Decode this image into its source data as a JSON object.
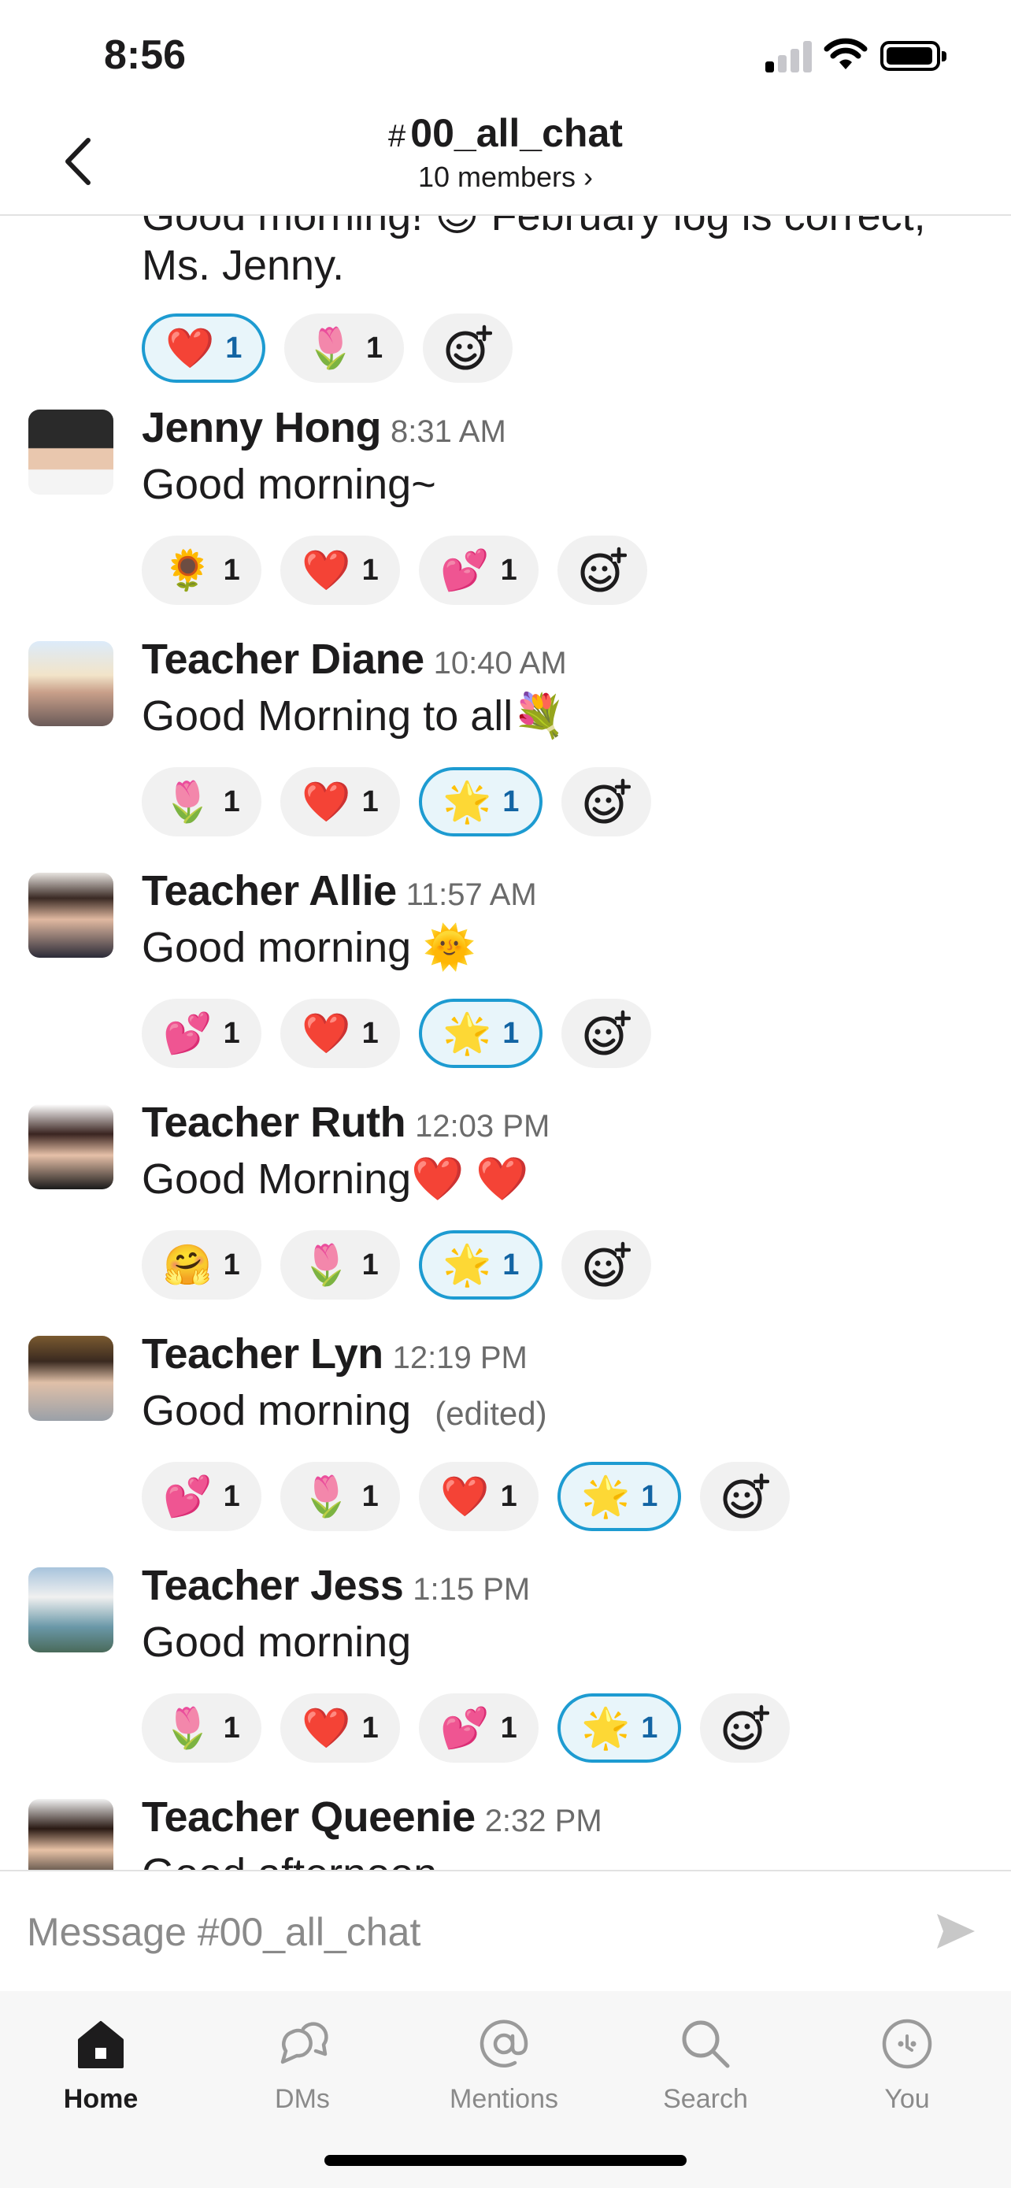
{
  "status": {
    "time": "8:56"
  },
  "header": {
    "hash": "#",
    "channel": "00_all_chat",
    "members": "10 members",
    "members_chevron": "›"
  },
  "partial": {
    "text_line1": "Good morning! 😊 February log is correct,",
    "text_line2": "Ms. Jenny.",
    "reactions": [
      {
        "emoji": "❤️",
        "count": "1",
        "active": true
      },
      {
        "emoji": "🌷",
        "count": "1",
        "active": false
      }
    ]
  },
  "messages": [
    {
      "name": "Jenny Hong",
      "time": "8:31 AM",
      "text": "Good morning~",
      "edited": "",
      "reactions": [
        {
          "emoji": "🌻",
          "count": "1"
        },
        {
          "emoji": "❤️",
          "count": "1"
        },
        {
          "emoji": "💕",
          "count": "1"
        }
      ]
    },
    {
      "name": "Teacher Diane",
      "time": "10:40 AM",
      "text": "Good Morning to all💐",
      "edited": "",
      "reactions": [
        {
          "emoji": "🌷",
          "count": "1"
        },
        {
          "emoji": "❤️",
          "count": "1"
        },
        {
          "emoji": "🌟",
          "count": "1",
          "active": true
        }
      ]
    },
    {
      "name": "Teacher Allie",
      "time": "11:57 AM",
      "text": "Good morning  🌞",
      "edited": "",
      "reactions": [
        {
          "emoji": "💕",
          "count": "1"
        },
        {
          "emoji": "❤️",
          "count": "1"
        },
        {
          "emoji": "🌟",
          "count": "1",
          "active": true
        }
      ]
    },
    {
      "name": "Teacher Ruth",
      "time": "12:03 PM",
      "text": "Good Morning❤️  ❤️",
      "edited": "",
      "reactions": [
        {
          "emoji": "🤗",
          "count": "1"
        },
        {
          "emoji": "🌷",
          "count": "1"
        },
        {
          "emoji": "🌟",
          "count": "1",
          "active": true
        }
      ]
    },
    {
      "name": "Teacher Lyn",
      "time": "12:19 PM",
      "text": "Good morning",
      "edited": "(edited)",
      "reactions": [
        {
          "emoji": "💕",
          "count": "1"
        },
        {
          "emoji": "🌷",
          "count": "1"
        },
        {
          "emoji": "❤️",
          "count": "1"
        },
        {
          "emoji": "🌟",
          "count": "1",
          "active": true
        }
      ]
    },
    {
      "name": "Teacher Jess",
      "time": "1:15 PM",
      "text": "Good morning",
      "edited": "",
      "reactions": [
        {
          "emoji": "🌷",
          "count": "1"
        },
        {
          "emoji": "❤️",
          "count": "1"
        },
        {
          "emoji": "💕",
          "count": "1"
        },
        {
          "emoji": "🌟",
          "count": "1",
          "active": true
        }
      ]
    },
    {
      "name": "Teacher Queenie",
      "time": "2:32 PM",
      "text": "Good afternoon",
      "edited": "",
      "reactions": []
    }
  ],
  "composer": {
    "placeholder": "Message #00_all_chat"
  },
  "tabs": [
    {
      "label": "Home",
      "icon": "home-icon",
      "active": true
    },
    {
      "label": "DMs",
      "icon": "dms-icon"
    },
    {
      "label": "Mentions",
      "icon": "mentions-icon"
    },
    {
      "label": "Search",
      "icon": "search-icon"
    },
    {
      "label": "You",
      "icon": "you-icon"
    }
  ],
  "colors": {
    "accent": "#1d9bd1",
    "active_pill_bg": "#e8f5fa",
    "pill_bg": "#f1f1f1",
    "text": "#1d1c1d",
    "muted": "#6b6b6b"
  }
}
